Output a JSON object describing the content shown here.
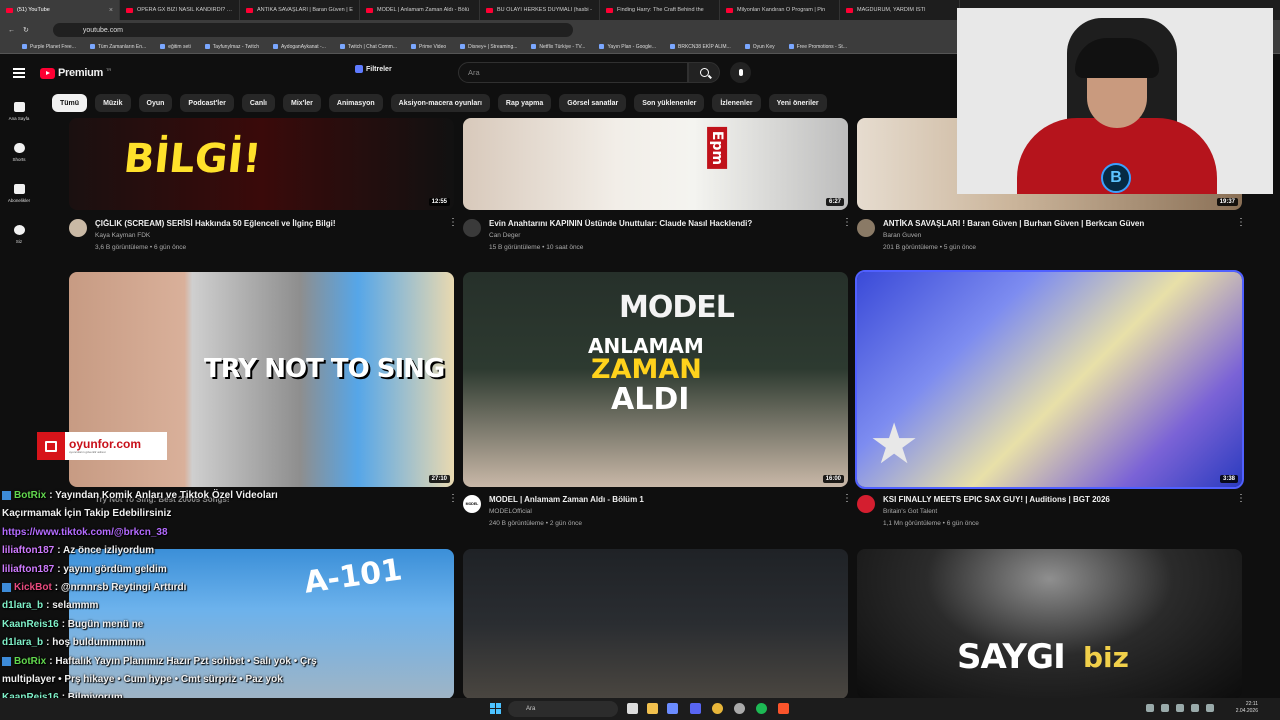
{
  "browser": {
    "tabs": [
      {
        "label": "(51) YouTube",
        "active": true
      },
      {
        "label": "OPERA GX BİZİ NASIL KANDIRDI? - Y"
      },
      {
        "label": "ANTİKA SAVAŞLARI | Baran Güven | E"
      },
      {
        "label": "MODEL | Anlamam Zaman Aldı - Bölü"
      },
      {
        "label": "BU OLAYI HERKES DUYMALI (hasbi -"
      },
      {
        "label": "Finding Harry: The Craft Behind the"
      },
      {
        "label": "Milyonları Kandıran O Program | Pin"
      },
      {
        "label": "MAĞDURUM, YARDIM İSTİ"
      }
    ],
    "url": "youtube.com",
    "bookmarks": [
      "Purple Planet Free...",
      "Tüm Zamanların En...",
      "eğitim seti",
      "Tayfunylmaz - Twitch",
      "AydoganAykanat -...",
      "Twitch | Chat Comm...",
      "Prime Video",
      "Disney+ | Streaming...",
      "Netflix Türkiye - TV...",
      "Yayın Plan - Google...",
      "BRKCN38 EKİP ALIM...",
      "Oyun Key",
      "Free Promotions - St..."
    ]
  },
  "header": {
    "logo": "Premium",
    "logo_sup": "TR",
    "filters": "Filtreler",
    "search_placeholder": "Ara"
  },
  "sidebar": [
    {
      "label": "Ana Sayfa",
      "icon": "home-icon"
    },
    {
      "label": "Shorts",
      "icon": "shorts-icon"
    },
    {
      "label": "Abonelikler",
      "icon": "subscriptions-icon"
    },
    {
      "label": "Siz",
      "icon": "you-icon"
    }
  ],
  "chips": [
    "Tümü",
    "Müzik",
    "Oyun",
    "Podcast'ler",
    "Canlı",
    "Mix'ler",
    "Animasyon",
    "Aksiyon-macera oyunları",
    "Rap yapma",
    "Görsel sanatlar",
    "Son yüklenenler",
    "İzlenenler",
    "Yeni öneriler"
  ],
  "videos": [
    {
      "title": "ÇIĞLIK (SCREAM) SERİSİ Hakkında 50 Eğlenceli ve İlginç Bilgi!",
      "channel": "Kaya Kayman FDK",
      "stats": "3,6 B görüntüleme • 6 gün önce",
      "duration": "12:55",
      "caption": "BİLGİ!"
    },
    {
      "title": "Evin Anahtarını KAPININ Üstünde Unuttular: Claude Nasıl Hacklendi?",
      "channel": "Can Deger",
      "stats": "15 B görüntüleme • 10 saat önce",
      "duration": "6:27",
      "caption": "Epm"
    },
    {
      "title": "ANTİKA SAVAŞLARI ! Baran Güven | Burhan Güven | Berkcan Güven",
      "channel": "Baran Guven",
      "stats": "201 B görüntüleme • 5 gün önce",
      "duration": "19:37"
    },
    {
      "title": "Try Not To Sing: Best 2000s Songs!",
      "channel": "",
      "stats": "",
      "duration": "27:10",
      "caption": "TRY NOT TO SING"
    },
    {
      "title": "MODEL | Anlamam Zaman Aldı - Bölüm 1",
      "channel": "MODELOfficial",
      "stats": "240 B görüntüleme • 2 gün önce",
      "duration": "16:00",
      "cap1": "MODEL",
      "cap2": "ANLAMAM",
      "cap3": "ZAMAN",
      "cap4": "ALDI",
      "avatar_text": "MODEL"
    },
    {
      "title": "KSI FINALLY MEETS EPIC SAX GUY! | Auditions | BGT 2026",
      "channel": "Britain's Got Talent",
      "stats": "1,1 Mn görüntüleme • 6 gün önce",
      "duration": "3:38"
    },
    {
      "caption": "A-101"
    },
    {},
    {
      "caption": "SAYGI",
      "caption_b": "biz"
    }
  ],
  "overlay": {
    "oyunfor": "oyunfor.com",
    "oyunfor_sub": "oyuncuların güvenilir adresi",
    "chat": [
      {
        "user": "BotRix",
        "user_color": "#62d84e",
        "badge": true,
        "text": ": Yayından Komik Anları ve Tiktok Özel Videoları Kaçırmamak İçin Takip Edebilirsiniz"
      },
      {
        "user": "",
        "user_color": "#b46bff",
        "badge": false,
        "text": "https://www.tiktok.com/@brkcn_38",
        "text_color": "#b46bff"
      },
      {
        "user": "liliafton187",
        "user_color": "#cf7bff",
        "badge": false,
        "text": ": Az önce izliyordum"
      },
      {
        "user": "liliafton187",
        "user_color": "#cf7bff",
        "badge": false,
        "text": ": yayını gördüm geldim"
      },
      {
        "user": "KickBot",
        "user_color": "#e94b7f",
        "badge": true,
        "text": ": @nrnnrsb  Reytingi Arttırdı"
      },
      {
        "user": "d1lara_b",
        "user_color": "#7ff0c8",
        "badge": false,
        "text": ": selammm"
      },
      {
        "user": "KaanReis16",
        "user_color": "#7ff0c8",
        "badge": false,
        "text": ": Bugün menü ne"
      },
      {
        "user": "d1lara_b",
        "user_color": "#7ff0c8",
        "badge": false,
        "text": ": hoş buldummmmm"
      },
      {
        "user": "BotRix",
        "user_color": "#62d84e",
        "badge": true,
        "text": ": Haftalık Yayın Planımız Hazır Pzt sohbet • Salı yok • Çrş multiplayer • Prş hikaye • Cum hype • Cmt sürpriz • Paz yok"
      },
      {
        "user": "KaanReis16",
        "user_color": "#7ff0c8",
        "badge": false,
        "text": ": Bilmiyorum"
      }
    ]
  },
  "taskbar": {
    "search": "Ara",
    "time": "22:11",
    "date": "2.04.2026"
  }
}
